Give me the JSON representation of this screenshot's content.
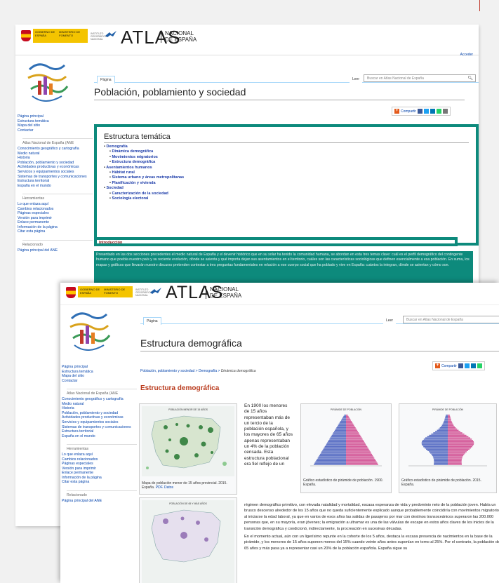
{
  "brand": {
    "gov_line1": "GOBIERNO DE ESPAÑA",
    "gov_line2": "MINISTERIO DE FOMENTO",
    "inst": "INSTITUTO GEOGRÁFICO NACIONAL",
    "atlas": "ATLAS",
    "nacional_1": "NACIONAL",
    "nacional_2": "DE ESPAÑA"
  },
  "window1": {
    "login": "Acceder",
    "tab_page": "Página",
    "tab_read": "Leer",
    "search_placeholder": "Buscar en Atlas Nacional de España",
    "title": "Población, poblamiento y sociedad",
    "share": "Compartir",
    "structure_title": "Estructura temática",
    "tree": [
      {
        "label": "Demografía",
        "children": [
          "Dinámica demográfica",
          "Movimientos migratorios",
          "Estructura demográfica"
        ]
      },
      {
        "label": "Asentamientos humanos",
        "children": [
          "Hábitat rural",
          "Sistema urbano y áreas metropolitanas",
          "Planificación y vivienda"
        ]
      },
      {
        "label": "Sociedad",
        "children": [
          "Caracterización de la sociedad",
          "Sociología electoral"
        ]
      }
    ],
    "intro_heading": "Introducción",
    "intro_text": "Presentado en las dos secciones precedentes el medio natural de España y el devenir histórico que en su solar ha tenido la comunidad humana, se abordan en esta tres temas clave: cuál es el perfil demográfico del contingente humano que poebla nuestro país y su reciente evolución, dónde se asienta y qué importa dejan sus asentamientos en el territorio, cuáles son las características sociológicas que definen esencialmente a esa población. En suma, los mapas y gráficos que llevarán nuestro discurso pretenden contestar a tres preguntas fundamentales en relación a ese cuerpo social que ha poblado y vive en España: cuántos la integran, dónde se asientan y cómo son."
  },
  "sidebar": {
    "nav": [
      "Página principal",
      "Estructura temática",
      "Mapa del sitio",
      "Contactar"
    ],
    "ane_head": "Atlas Nacional de España (ANE",
    "ane": [
      "Conocimiento geográfico y cartografía",
      "Medio natural",
      "Historia",
      "Población, poblamiento y sociedad",
      "Actividades productivas y económicas",
      "Servicios y equipamientos sociales",
      "Sistemas de transportes y comunicaciones",
      "Estructura territorial",
      "España en el mundo"
    ],
    "tools_head": "Herramientas",
    "tools": [
      "Lo que enlaza aquí",
      "Cambios relacionados",
      "Páginas especiales",
      "Versión para imprimir",
      "Enlace permanente",
      "Información de la página",
      "Citar esta página"
    ],
    "related_head": "Relacionado",
    "related": [
      "Página principal del ANE"
    ]
  },
  "window2": {
    "tab_page": "Página",
    "tab_read": "Leer",
    "search_placeholder": "Buscar en Atlas Nacional de España",
    "title": "Estructura demográfica",
    "crumb_1": "Población, poblamiento y sociedad",
    "crumb_2": "Demografía",
    "crumb_3": "Dinámica demográfica",
    "share": "Compartir",
    "section_heading": "Estructura demográfica",
    "fig1_caption": "Mapa de población menor de 15 años provincial. 2015. España.",
    "fig1_links": "PDF. Datos",
    "fig1_map_title": "POBLACIÓN MENOR DE 15 AÑOS",
    "fig2_caption": "Gráfico estadístico de pirámide de población. 1900. España.",
    "fig2_chart_title": "PIRÁMIDE DE POBLACIÓN",
    "fig3_caption": "Gráfico estadístico de pirámide de población. 2015. España.",
    "fig3_chart_title": "PIRÁMIDE DE POBLACIÓN",
    "fig4_map_title": "POBLACIÓN DE 65 Y MÁS AÑOS",
    "column_text": "En 1900 los menores de 15 años representaban más de un tercio de la población española, y los mayores de 65 años apenas representaban un 4% de la población censada. Esta estructura poblacional era fiel reflejo de un",
    "para1": "régimen demográfico primitivo, con elevada natalidad y mortalidad, escasa esperanza de vida y predominio neto de la población joven. Había un brusco descenso alrededor de los 15 años que no queda suficientemente explicado aunque probablemente coincidiría con movimientos migratorios al iniciarse la edad laboral, ya que en varios de esos años las salidas de pasajeros por mar con destinos transoceánicos superaron las 200.000 personas que, en su mayoría, eran jóvenes; la emigración a ultramar es una de las válvulas de escape en estos años claves de los inicios de la transición demográfica y condicionó, indirectamente, la procreación en sucesivas décadas.",
    "para2": "En el momento actual, aún con un ligerísimo repunte en la cohorte de los 5 años, destaca la escasa presencia de nacimientos en la base de la pirámide, y los menores de 15 años suponen menos del 15% cuando veinte años antes suponían en torno al 25%. Por el contrario, la población de 65 años y más pasa ya a representar casi un 20% de la población española. España sigue su"
  },
  "colors": {
    "teal": "#0d8a7c",
    "link": "#0645ad",
    "heading_red": "#b93a1c",
    "pyramid_male": "#5a6fc4",
    "pyramid_female": "#d45b9a"
  }
}
